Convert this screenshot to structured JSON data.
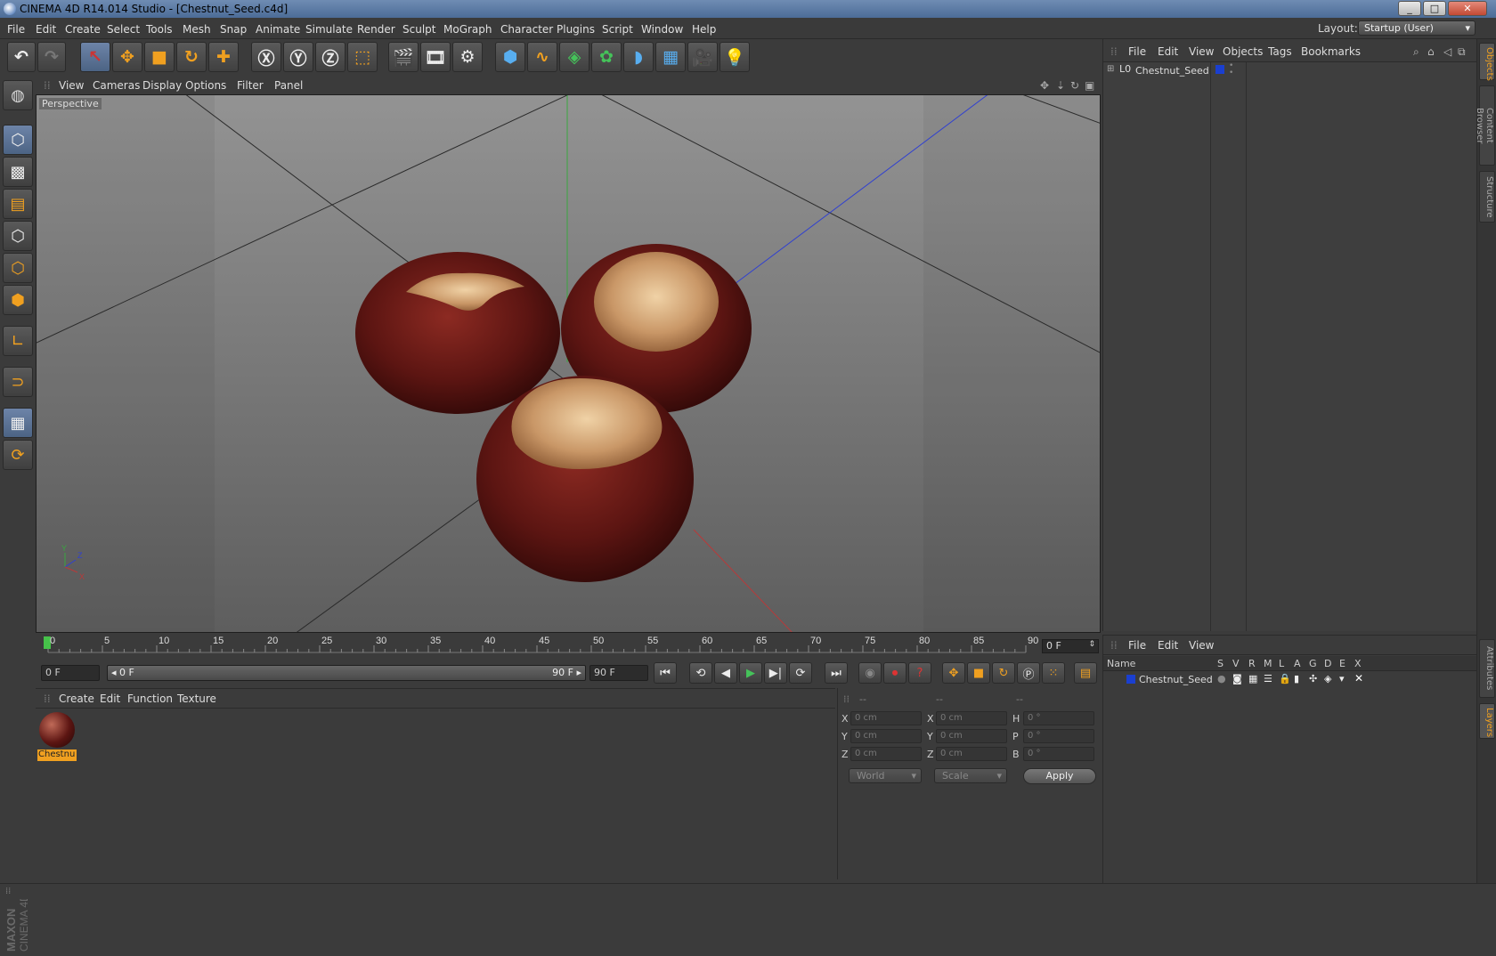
{
  "window": {
    "title": "CINEMA 4D R14.014 Studio - [Chestnut_Seed.c4d]",
    "minimize": "_",
    "maximize": "□",
    "close": "✕"
  },
  "menubar": {
    "items": [
      "File",
      "Edit",
      "Create",
      "Select",
      "Tools",
      "Mesh",
      "Snap",
      "Animate",
      "Simulate",
      "Render",
      "Sculpt",
      "MoGraph",
      "Character",
      "Plugins",
      "Script",
      "Window",
      "Help"
    ],
    "layout_label": "Layout:",
    "layout_value": "Startup (User)"
  },
  "toolbar": {
    "icons": [
      "undo-icon",
      "redo-icon",
      "live-selection-icon",
      "move-icon",
      "scale-icon",
      "rotate-icon",
      "add-icon",
      "x-axis-icon",
      "y-axis-icon",
      "z-axis-icon",
      "coordinate-system-icon",
      "render-view-icon",
      "render-picture-viewer-icon",
      "edit-render-settings-icon",
      "cube-icon",
      "spline-icon",
      "nurbs-icon",
      "mograph-cloner-icon",
      "deformer-icon",
      "floor-icon",
      "camera-icon",
      "light-icon"
    ]
  },
  "viewport": {
    "menu": [
      "View",
      "Cameras",
      "Display",
      "Options",
      "Filter",
      "Panel"
    ],
    "label": "Perspective",
    "axis": {
      "x": "X",
      "y": "Y",
      "z": "Z"
    }
  },
  "timeline": {
    "ticks": [
      "0",
      "5",
      "10",
      "15",
      "20",
      "25",
      "30",
      "35",
      "40",
      "45",
      "50",
      "55",
      "60",
      "65",
      "70",
      "75",
      "80",
      "85",
      "90"
    ],
    "current_frame": "0 F"
  },
  "transport": {
    "start_field": "0 F",
    "range_start": "◂ 0 F",
    "range_end": "90 F ▸",
    "end_field": "90 F"
  },
  "materials": {
    "menu": [
      "Create",
      "Edit",
      "Function",
      "Texture"
    ],
    "items": [
      {
        "name": "Chestnu"
      }
    ]
  },
  "coordinates": {
    "headers": [
      "--",
      "--",
      "--"
    ],
    "rows": [
      {
        "label1": "X",
        "val1": "0 cm",
        "label2": "X",
        "val2": "0 cm",
        "label3": "H",
        "val3": "0 °"
      },
      {
        "label1": "Y",
        "val1": "0 cm",
        "label2": "Y",
        "val2": "0 cm",
        "label3": "P",
        "val3": "0 °"
      },
      {
        "label1": "Z",
        "val1": "0 cm",
        "label2": "Z",
        "val2": "0 cm",
        "label3": "B",
        "val3": "0 °"
      }
    ],
    "mode": "World",
    "transform": "Scale",
    "apply": "Apply"
  },
  "object_manager": {
    "menu": [
      "File",
      "Edit",
      "View",
      "Objects",
      "Tags",
      "Bookmarks"
    ],
    "objects": [
      {
        "name": "Chestnut_Seed",
        "color": "#1a3fd0"
      }
    ]
  },
  "layer_manager": {
    "menu": [
      "File",
      "Edit",
      "View"
    ],
    "columns": {
      "name": "Name",
      "flags": [
        "S",
        "V",
        "R",
        "M",
        "L",
        "A",
        "G",
        "D",
        "E",
        "X"
      ]
    },
    "layers": [
      {
        "name": "Chestnut_Seed",
        "color": "#1a3fd0"
      }
    ]
  },
  "side_tabs": [
    "Objects",
    "Content Browser",
    "Structure",
    "Attributes",
    "Layers"
  ],
  "branding": {
    "maxon": "MAXON",
    "product": "CINEMA 4D"
  }
}
